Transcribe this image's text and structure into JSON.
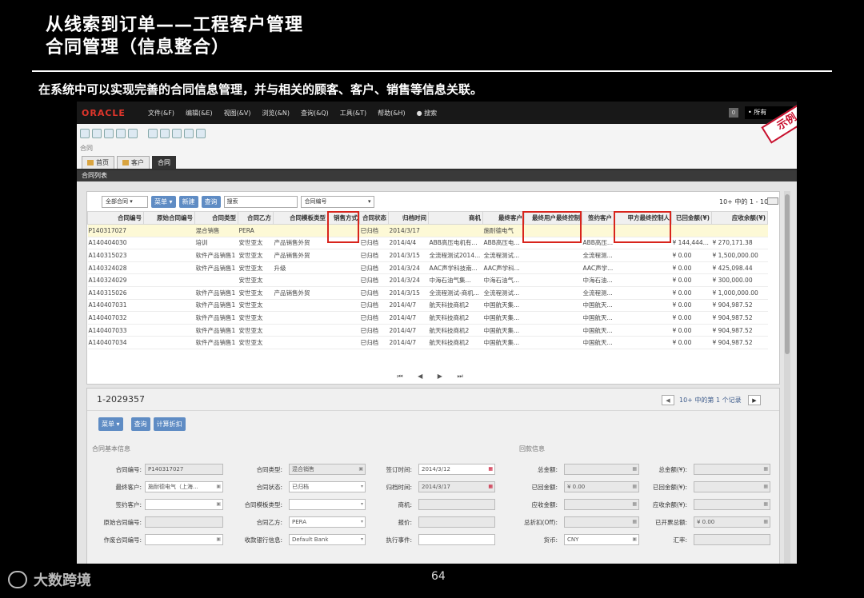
{
  "slide": {
    "title_line1": "从线索到订单——工程客户管理",
    "title_line2": "合同管理（信息整合）",
    "subtitle": "在系统中可以实现完善的合同信息管理，并与相关的顾客、客户、销售等信息关联。",
    "page_number": "64",
    "footer_brand": "大数跨境"
  },
  "menubar": {
    "logo": "ORACLE",
    "items": [
      "文件(&F)",
      "编辑(&E)",
      "视图(&V)",
      "浏览(&N)",
      "查询(&Q)",
      "工具(&T)",
      "帮助(&H)",
      "● 搜索"
    ],
    "num": "0",
    "all": "• 所有"
  },
  "stamp": "示例",
  "breadcrumb": "合同",
  "tabs": [
    "首页",
    "客户",
    "合同"
  ],
  "list": {
    "title": "合同列表",
    "scope_select": "全部合同",
    "menu_btn": "菜单 ▾",
    "new_btn": "新建",
    "query_btn": "查询",
    "search_placeholder": "搜索",
    "field_select": "合同编号",
    "page_count": "10+ 中的 1 - 10"
  },
  "columns": [
    "合同编号",
    "原始合同编号",
    "合同类型",
    "合同乙方",
    "合同模板类型",
    "销售方式",
    "合同状态",
    "归档时间",
    "商机",
    "最终客户",
    "最终用户最终控制",
    "签约客户",
    "甲方最终控制人",
    "已回金额(¥)",
    "应收余额(¥)"
  ],
  "rows": [
    {
      "cells": [
        "P140317027",
        "",
        "混合销售",
        "PERA",
        "",
        "",
        "已归档",
        "2014/3/17",
        "",
        "施耐德电气",
        "",
        "",
        "",
        "",
        ""
      ]
    },
    {
      "cells": [
        "A140404030",
        "",
        "培训",
        "安世亚太",
        "产品销售外贸",
        "",
        "已归档",
        "2014/4/4",
        "ABB高压电机有...",
        "ABB高压电...",
        "",
        "ABB高压...",
        "",
        "¥ 144,444...",
        "¥ 270,171.38"
      ]
    },
    {
      "cells": [
        "A140315023",
        "",
        "软件产品销售1",
        "安世亚太",
        "产品销售外贸",
        "",
        "已归档",
        "2014/3/15",
        "全流程测试2014...",
        "全流程测试...",
        "",
        "全流程测...",
        "",
        "¥ 0.00",
        "¥ 1,500,000.00"
      ]
    },
    {
      "cells": [
        "A140324028",
        "",
        "软件产品销售1",
        "安世亚太",
        "升级",
        "",
        "已归档",
        "2014/3/24",
        "AAC声学科技南...",
        "AAC声学科...",
        "",
        "AAC声学...",
        "",
        "¥ 0.00",
        "¥ 425,098.44"
      ]
    },
    {
      "cells": [
        "A140324029",
        "",
        "",
        "安世亚太",
        "",
        "",
        "已归档",
        "2014/3/24",
        "中海石油气集...",
        "中海石油气...",
        "",
        "中海石油...",
        "",
        "¥ 0.00",
        "¥ 300,000.00"
      ]
    },
    {
      "cells": [
        "A140315026",
        "",
        "软件产品销售1",
        "安世亚太",
        "产品销售外贸",
        "",
        "已归档",
        "2014/3/15",
        "全流程测试-商机...",
        "全流程测试...",
        "",
        "全流程测...",
        "",
        "¥ 0.00",
        "¥ 1,000,000.00"
      ]
    },
    {
      "cells": [
        "A140407031",
        "",
        "软件产品销售1",
        "安世亚太",
        "",
        "",
        "已归档",
        "2014/4/7",
        "航天科技商机2",
        "中国航天集...",
        "",
        "中国航天...",
        "",
        "¥ 0.00",
        "¥ 904,987.52"
      ]
    },
    {
      "cells": [
        "A140407032",
        "",
        "软件产品销售1",
        "安世亚太",
        "",
        "",
        "已归档",
        "2014/4/7",
        "航天科技商机2",
        "中国航天集...",
        "",
        "中国航天...",
        "",
        "¥ 0.00",
        "¥ 904,987.52"
      ]
    },
    {
      "cells": [
        "A140407033",
        "",
        "软件产品销售1",
        "安世亚太",
        "",
        "",
        "已归档",
        "2014/4/7",
        "航天科技商机2",
        "中国航天集...",
        "",
        "中国航天...",
        "",
        "¥ 0.00",
        "¥ 904,987.52"
      ]
    },
    {
      "cells": [
        "A140407034",
        "",
        "软件产品销售1",
        "安世亚太",
        "",
        "",
        "已归档",
        "2014/4/7",
        "航天科技商机2",
        "中国航天集...",
        "",
        "中国航天...",
        "",
        "¥ 0.00",
        "¥ 904,987.52"
      ]
    }
  ],
  "pager": "⏮ ◀ ▶ ⏭",
  "detail": {
    "record_id": "1-2029357",
    "record_label": "10+ 中的第 1 个记录",
    "menu_btn": "菜单 ▾",
    "query_btn": "查询",
    "calc_btn": "计算折扣",
    "section_basic": "合同基本信息",
    "section_finance": "回款信息",
    "f_contract_no_lbl": "合同编号:",
    "f_contract_no": "P140317027",
    "f_final_cust_lbl": "最终客户:",
    "f_final_cust": "施耐德电气（上海...",
    "f_sign_cust_lbl": "签约客户:",
    "f_orig_no_lbl": "原始合同编号:",
    "f_void_no_lbl": "作废合同编号:",
    "f_type_lbl": "合同类型:",
    "f_type": "混合销售",
    "f_status_lbl": "合同状态:",
    "f_status": "已归档",
    "f_tmpl_lbl": "合同模板类型:",
    "f_partyb_lbl": "合同乙方:",
    "f_partyb": "PERA",
    "f_bank_lbl": "收款银行信息:",
    "f_bank": "Default Bank",
    "f_sign_time_lbl": "签订时间:",
    "f_sign_time": "2014/3/12",
    "f_archive_lbl": "归档时间:",
    "f_archive": "2014/3/17",
    "f_opp_lbl": "商机:",
    "f_quote_lbl": "报价:",
    "f_exec_lbl": "执行事件:",
    "f_total_lbl": "总金额:",
    "f_paid_lbl": "已回金额:",
    "f_paid": "¥ 0.00",
    "f_recv_lbl": "应收金额:",
    "f_disc_lbl": "总折扣(Off):",
    "f_cur_lbl": "货币:",
    "f_cur": "CNY",
    "f_total_y_lbl": "总金额(¥):",
    "f_paid_y_lbl": "已回金额(¥):",
    "f_bal_y_lbl": "应收余额(¥):",
    "f_inv_lbl": "已开票总额:",
    "f_inv": "¥ 0.00",
    "f_rate_lbl": "汇率:"
  }
}
